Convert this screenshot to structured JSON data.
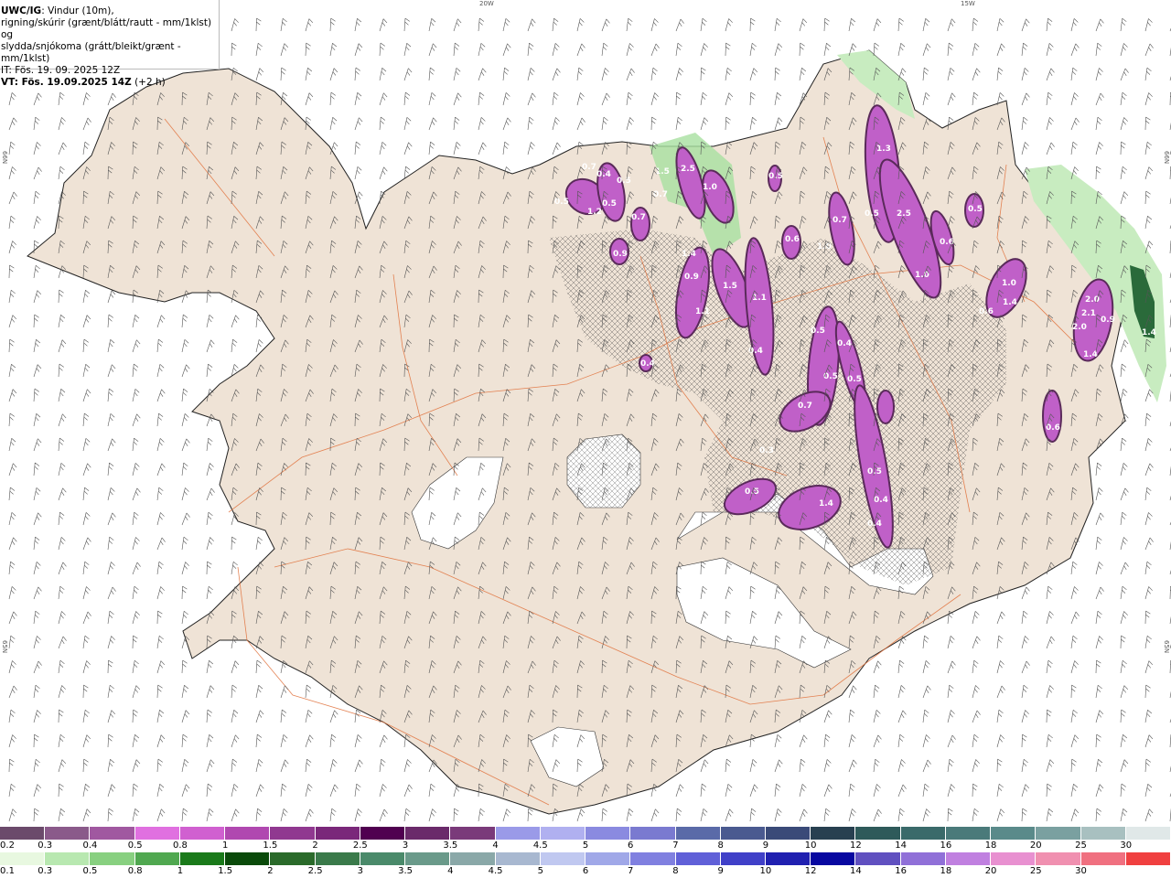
{
  "header": {
    "source": "UWC/IG",
    "line1_rest": ": Vindur (10m),",
    "line2": "rigning/skúrir (grænt/blátt/rautt - mm/1klst) og",
    "line3": "slydda/snjókoma (grátt/bleikt/grænt - mm/1klst)",
    "it": "IT: Fös. 19. 09. 2025 12Z",
    "vt_bold": "VT: Fös. 19.09.2025 14Z",
    "vt_rest": " (+2 h)"
  },
  "graticule": {
    "top": [
      "20W",
      "15W"
    ],
    "left": [
      "66N",
      "65N"
    ],
    "right": [
      "66N",
      "65N"
    ]
  },
  "precip_labels": [
    "0.5",
    "0.7",
    "0.4",
    "0.5",
    "1.5",
    "2.5",
    "1.0",
    "0.7",
    "0.5",
    "1.2",
    "0.7",
    "0.9",
    "1.4",
    "0.9",
    "1.5",
    "1.1",
    "1.1",
    "0.4",
    "0.4",
    "0.5",
    "0.6",
    "1.0",
    "0.7",
    "0.5",
    "2.5",
    "0.6",
    "1.0",
    "0.5",
    "1.3",
    "0.6",
    "1.0",
    "1.4",
    "1.4",
    "2.0",
    "2.1",
    "2.0",
    "0.9",
    "0.5",
    "0.4",
    "0.5",
    "0.7",
    "0.5",
    "0.6",
    "0.3",
    "0.5",
    "1.4",
    "0.5",
    "0.4",
    "0.4",
    "1.4"
  ],
  "legend": {
    "snow": {
      "labels": [
        "0.2",
        "0.3",
        "0.4",
        "0.5",
        "0.8",
        "1",
        "1.5",
        "2",
        "2.5",
        "3",
        "3.5",
        "4",
        "4.5",
        "5",
        "6",
        "7",
        "8",
        "9",
        "10",
        "12",
        "14",
        "16",
        "18",
        "20",
        "25",
        "30"
      ],
      "colors": [
        "#6b4a6b",
        "#8a5a8a",
        "#a058a0",
        "#e070e0",
        "#d060d0",
        "#b048b0",
        "#903890",
        "#7a287a",
        "#500050",
        "#6a2a6a",
        "#7a3a7a",
        "#9a9ae8",
        "#b0b0f0",
        "#8a8ae0",
        "#7a7ad0",
        "#5a6aa8",
        "#4a5a90",
        "#3a4a78",
        "#284050",
        "#2e5a5a",
        "#3a6a6a",
        "#4a7a7a",
        "#5a8a8a",
        "#7aa0a0",
        "#a8c0c0",
        "#e0e8e8"
      ]
    },
    "rain": {
      "labels": [
        "0.1",
        "0.3",
        "0.5",
        "0.8",
        "1",
        "1.5",
        "2",
        "2.5",
        "3",
        "3.5",
        "4",
        "4.5",
        "5",
        "6",
        "7",
        "8",
        "9",
        "10",
        "12",
        "14",
        "16",
        "18",
        "20",
        "25",
        "30"
      ],
      "colors": [
        "#e8f8e0",
        "#b8e8b0",
        "#88d080",
        "#50a850",
        "#1a7a1a",
        "#0a4a0a",
        "#2a6a2a",
        "#3a7a4a",
        "#4a8a6a",
        "#6a9a8a",
        "#8aa8a8",
        "#a8b8d0",
        "#c0c8f0",
        "#a0a8e8",
        "#8080e0",
        "#6060d8",
        "#4040c8",
        "#2020b0",
        "#0808a0",
        "#6050c0",
        "#9070d8",
        "#c080e0",
        "#e890d0",
        "#f090b0",
        "#f07080",
        "#f04040"
      ]
    }
  }
}
